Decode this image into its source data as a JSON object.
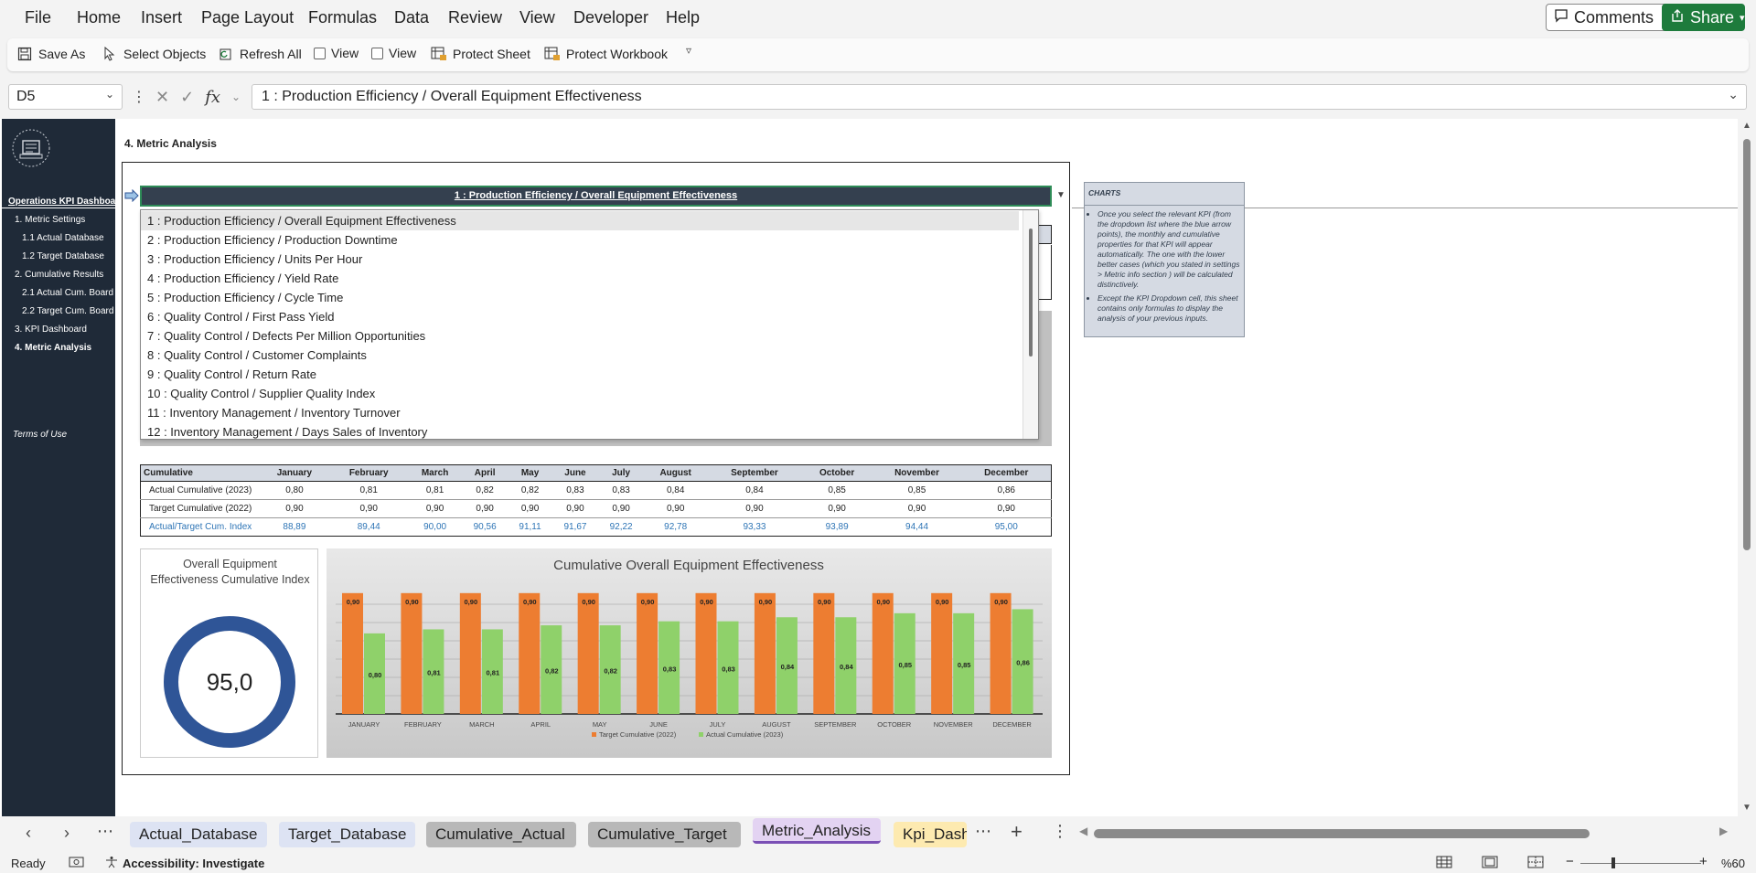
{
  "menu": {
    "items": [
      "File",
      "Home",
      "Insert",
      "Page Layout",
      "Formulas",
      "Data",
      "Review",
      "View",
      "Developer",
      "Help"
    ],
    "comments_label": "Comments",
    "share_label": "Share"
  },
  "toolbar": {
    "save_as": "Save As",
    "select_objects": "Select Objects",
    "refresh_all": "Refresh All",
    "view1": "View",
    "view2": "View",
    "protect_sheet": "Protect Sheet",
    "protect_workbook": "Protect Workbook"
  },
  "formula_bar": {
    "cell_ref": "D5",
    "fx": "fx",
    "content": "1 : Production Efficiency / Overall Equipment Effectiveness"
  },
  "sidebar": {
    "title": "Operations KPI Dashboard",
    "items": [
      {
        "label": "1. Metric Settings",
        "level": 1,
        "active": false
      },
      {
        "label": "1.1 Actual Database",
        "level": 2,
        "active": false
      },
      {
        "label": "1.2 Target Database",
        "level": 2,
        "active": false
      },
      {
        "label": "2. Cumulative Results",
        "level": 1,
        "active": false
      },
      {
        "label": "2.1 Actual Cum. Board",
        "level": 2,
        "active": false
      },
      {
        "label": "2.2 Target Cum. Board",
        "level": 2,
        "active": false
      },
      {
        "label": "3. KPI Dashboard",
        "level": 1,
        "active": false
      },
      {
        "label": "4. Metric Analysis",
        "level": 1,
        "active": true
      }
    ],
    "terms": "Terms of Use"
  },
  "sheet": {
    "title": "4. Metric Analysis",
    "selected_kpi": "1 : Production Efficiency / Overall Equipment Effectiveness"
  },
  "dropdown": {
    "options": [
      "1 : Production Efficiency / Overall Equipment Effectiveness",
      "2 : Production Efficiency / Production Downtime",
      "3 : Production Efficiency / Units Per Hour",
      "4 : Production Efficiency / Yield Rate",
      "5 : Production Efficiency / Cycle Time",
      "6 : Quality Control / First Pass Yield",
      "7 : Quality Control / Defects Per Million Opportunities",
      "8 : Quality Control / Customer Complaints",
      "9 : Quality Control / Return Rate",
      "10 : Quality Control / Supplier Quality Index",
      "11 : Inventory Management / Inventory Turnover",
      "12 : Inventory Management / Days Sales of Inventory"
    ]
  },
  "charts_note": {
    "title": "CHARTS",
    "bullets": [
      "Once you select the relevant KPI (from the dropdown list where the blue arrow points), the monthly and cumulative properties for that KPI will appear automatically. The one with the lower better cases (which you stated in settings > Metric info section ) will be calculated distinctively.",
      "Except the KPI Dropdown cell, this sheet contains only formulas to display the analysis of your previous inputs."
    ]
  },
  "table": {
    "header": "Cumulative",
    "months": [
      "January",
      "February",
      "March",
      "April",
      "May",
      "June",
      "July",
      "August",
      "September",
      "October",
      "November",
      "December"
    ],
    "rows": [
      {
        "label": "Actual Cumulative (2023)",
        "values": [
          "0,80",
          "0,81",
          "0,81",
          "0,82",
          "0,82",
          "0,83",
          "0,83",
          "0,84",
          "0,84",
          "0,85",
          "0,85",
          "0,86"
        ]
      },
      {
        "label": "Target Cumulative (2022)",
        "values": [
          "0,90",
          "0,90",
          "0,90",
          "0,90",
          "0,90",
          "0,90",
          "0,90",
          "0,90",
          "0,90",
          "0,90",
          "0,90",
          "0,90"
        ]
      },
      {
        "label": "Actual/Target Cum. Index",
        "values": [
          "88,89",
          "89,44",
          "90,00",
          "90,56",
          "91,11",
          "91,67",
          "92,22",
          "92,78",
          "93,33",
          "93,89",
          "94,44",
          "95,00"
        ]
      }
    ]
  },
  "donut": {
    "title": "Overall Equipment Effectiveness Cumulative Index",
    "value_label": "95,0",
    "fraction": 1.0,
    "color": "#2f5597"
  },
  "chart_data": {
    "type": "bar",
    "title": "Cumulative Overall Equipment Effectiveness",
    "categories": [
      "JANUARY",
      "FEBRUARY",
      "MARCH",
      "APRIL",
      "MAY",
      "JUNE",
      "JULY",
      "AUGUST",
      "SEPTEMBER",
      "OCTOBER",
      "NOVEMBER",
      "DECEMBER"
    ],
    "series": [
      {
        "name": "Target Cumulative (2022)",
        "color": "#ed7d31",
        "values": [
          0.9,
          0.9,
          0.9,
          0.9,
          0.9,
          0.9,
          0.9,
          0.9,
          0.9,
          0.9,
          0.9,
          0.9
        ],
        "labels": [
          "0,90",
          "0,90",
          "0,90",
          "0,90",
          "0,90",
          "0,90",
          "0,90",
          "0,90",
          "0,90",
          "0,90",
          "0,90",
          "0,90"
        ]
      },
      {
        "name": "Actual Cumulative (2023)",
        "color": "#8fd16a",
        "values": [
          0.8,
          0.81,
          0.81,
          0.82,
          0.82,
          0.83,
          0.83,
          0.84,
          0.84,
          0.85,
          0.85,
          0.86
        ],
        "labels": [
          "0,80",
          "0,81",
          "0,81",
          "0,82",
          "0,82",
          "0,83",
          "0,83",
          "0,84",
          "0,84",
          "0,85",
          "0,85",
          "0,86"
        ]
      }
    ],
    "ylim": [
      0.6,
      0.92
    ],
    "grid": true,
    "legend_position": "bottom"
  },
  "tabs": {
    "items": [
      {
        "label": "Actual_Database",
        "color": "#dde3f3",
        "active": false
      },
      {
        "label": "Target_Database",
        "color": "#dde3f3",
        "active": false
      },
      {
        "label": "Cumulative_Actual",
        "color": "#b8b8b8",
        "active": false
      },
      {
        "label": "Cumulative_Target",
        "color": "#b8b8b8",
        "active": false
      },
      {
        "label": "Metric_Analysis",
        "color": "#e3d3f2",
        "active": true
      },
      {
        "label": "Kpi_Dash",
        "color": "#fdeab0",
        "active": false
      }
    ]
  },
  "status": {
    "ready": "Ready",
    "accessibility": "Accessibility: Investigate",
    "zoom": "%60"
  }
}
